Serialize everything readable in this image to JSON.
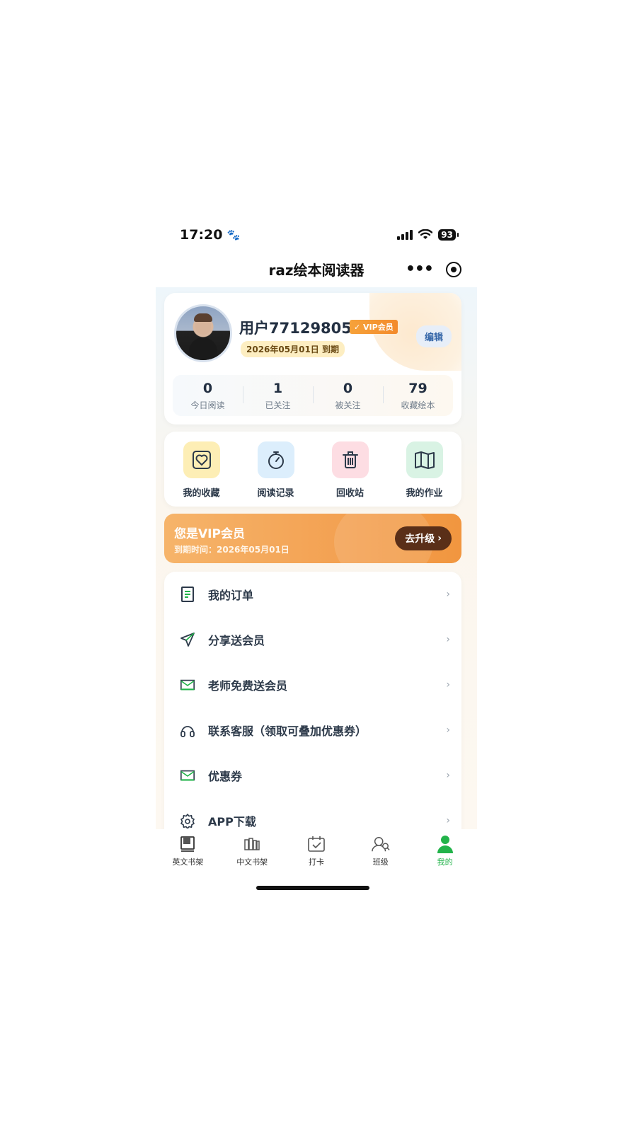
{
  "status_bar": {
    "time": "17:20",
    "battery": "93"
  },
  "nav": {
    "title": "raz绘本阅读器",
    "more_icon": "more-dots-icon",
    "close_icon": "target-close-icon"
  },
  "profile": {
    "username": "用户77129805",
    "vip_tag": "VIP会员",
    "expiry": "2026年05月01日 到期",
    "edit_label": "编辑",
    "stats": [
      {
        "value": "0",
        "label": "今日阅读"
      },
      {
        "value": "1",
        "label": "已关注"
      },
      {
        "value": "0",
        "label": "被关注"
      },
      {
        "value": "79",
        "label": "收藏绘本"
      }
    ]
  },
  "actions": [
    {
      "label": "我的收藏",
      "icon": "heart-box-icon",
      "bg": "#fdeeb5"
    },
    {
      "label": "阅读记录",
      "icon": "stopwatch-icon",
      "bg": "#dceefc"
    },
    {
      "label": "回收站",
      "icon": "trash-icon",
      "bg": "#fddde3"
    },
    {
      "label": "我的作业",
      "icon": "book-open-icon",
      "bg": "#d9f3e4"
    }
  ],
  "vip_banner": {
    "title": "您是VIP会员",
    "subtitle": "到期时间：2026年05月01日",
    "button": "去升级",
    "button_chevron": "›"
  },
  "menu": [
    {
      "label": "我的订单",
      "icon": "order-doc-icon"
    },
    {
      "label": "分享送会员",
      "icon": "send-icon"
    },
    {
      "label": "老师免费送会员",
      "icon": "mail-icon"
    },
    {
      "label": "联系客服（领取可叠加优惠券）",
      "icon": "headphones-icon"
    },
    {
      "label": "优惠券",
      "icon": "coupon-mail-icon"
    },
    {
      "label": "APP下载",
      "icon": "gear-icon"
    }
  ],
  "menu_chevron": "›",
  "tabs": [
    {
      "label": "英文书架",
      "icon": "book-icon",
      "active": false
    },
    {
      "label": "中文书架",
      "icon": "bookshelf-icon",
      "active": false
    },
    {
      "label": "打卡",
      "icon": "calendar-check-icon",
      "active": false
    },
    {
      "label": "班级",
      "icon": "class-users-icon",
      "active": false
    },
    {
      "label": "我的",
      "icon": "user-icon",
      "active": true
    }
  ],
  "colors": {
    "accent_green": "#22b34a",
    "vip_orange": "#f3a152",
    "upgrade_brown": "#5a2f18"
  }
}
